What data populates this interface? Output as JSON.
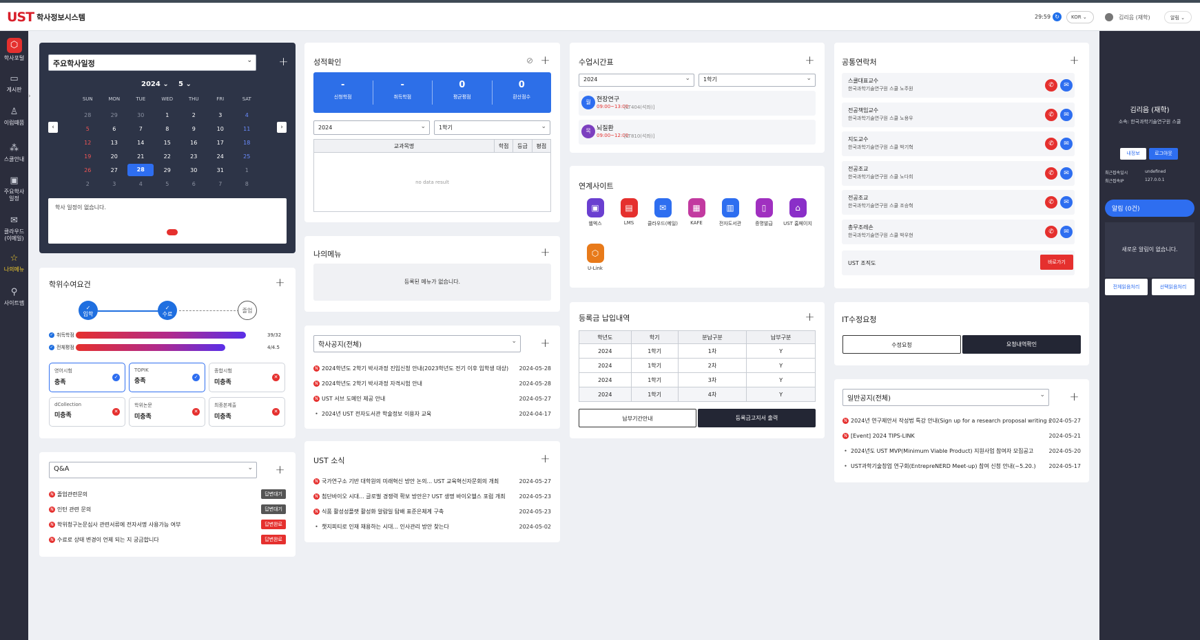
{
  "header": {
    "logo": "UST",
    "app_title": "학사정보시스템",
    "timer": "29:59",
    "lang": "KOR",
    "user_name": "김리음 (재학)",
    "alarm_label": "알림"
  },
  "sidebar": {
    "items": [
      {
        "label": "학사포털",
        "icon": "portal-icon"
      },
      {
        "label": "게시판",
        "icon": "board-icon"
      },
      {
        "label": "이럼때쯤",
        "icon": "person-icon"
      },
      {
        "label": "스쿨안내",
        "icon": "school-icon"
      },
      {
        "label": "주요학사일정",
        "icon": "schedule-icon"
      },
      {
        "label": "클라우드(이메일)",
        "icon": "mail-icon"
      },
      {
        "label": "나의메뉴",
        "icon": "star-icon"
      },
      {
        "label": "사이트맵",
        "icon": "sitemap-icon"
      }
    ]
  },
  "calendar": {
    "select": "주요학사일정",
    "year": "2024",
    "month": "5",
    "dow": [
      "SUN",
      "MON",
      "TUE",
      "WED",
      "THU",
      "FRI",
      "SAT"
    ],
    "weeks": [
      [
        "28",
        "29",
        "30",
        "1",
        "2",
        "3",
        "4"
      ],
      [
        "5",
        "6",
        "7",
        "8",
        "9",
        "10",
        "11"
      ],
      [
        "12",
        "13",
        "14",
        "15",
        "16",
        "17",
        "18"
      ],
      [
        "19",
        "20",
        "21",
        "22",
        "23",
        "24",
        "25"
      ],
      [
        "26",
        "27",
        "28",
        "29",
        "30",
        "31",
        "1"
      ],
      [
        "2",
        "3",
        "4",
        "5",
        "6",
        "7",
        "8"
      ]
    ],
    "empty_text": "학사 일정이 없습니다."
  },
  "degree": {
    "title": "학위수여요건",
    "steps": [
      "입학",
      "수료",
      "졸업"
    ],
    "bars": [
      {
        "label": "취득학점",
        "value": "39/32",
        "fill": 1.0
      },
      {
        "label": "전체평점",
        "value": "4/4.5",
        "fill": 0.88
      }
    ],
    "reqs": [
      {
        "title": "영어시험",
        "status": "충족",
        "ok": true
      },
      {
        "title": "TOPIK",
        "status": "충족",
        "ok": true
      },
      {
        "title": "종합시험",
        "status": "미충족",
        "ok": false
      },
      {
        "title": "dCollection",
        "status": "미충족",
        "ok": false
      },
      {
        "title": "학위논문",
        "status": "미충족",
        "ok": false
      },
      {
        "title": "최종본제출",
        "status": "미충족",
        "ok": false
      }
    ]
  },
  "qna": {
    "select": "Q&A",
    "items": [
      {
        "text": "졸업관련문의",
        "status": "답변대기",
        "done": false
      },
      {
        "text": "인턴 관련 문의",
        "status": "답변대기",
        "done": false
      },
      {
        "text": "학위청구논문심사 관련서류에 전자서명 사용가능 여부",
        "status": "답변완료",
        "done": true
      },
      {
        "text": "수료로 상태 변경이 언제 되는 지 궁금합니다",
        "status": "답변완료",
        "done": true
      }
    ]
  },
  "grades": {
    "title": "성적확인",
    "stats": [
      {
        "value": "-",
        "label": "신청학점"
      },
      {
        "value": "-",
        "label": "취득학점"
      },
      {
        "value": "0",
        "label": "평균평점"
      },
      {
        "value": "0",
        "label": "환산점수"
      }
    ],
    "year": "2024",
    "term": "1학기",
    "columns": [
      "교과목명",
      "학점",
      "등급",
      "평점"
    ],
    "empty": "no data result"
  },
  "mymenu": {
    "title": "나의메뉴",
    "empty": "등록된 메뉴가 없습니다."
  },
  "notice": {
    "select": "학사공지(전체)",
    "items": [
      {
        "text": "2024학년도 2학기 박사과정 진입신청 안내(2023학년도 전기 이후 입학생 대상)",
        "date": "2024-05-28",
        "new": true
      },
      {
        "text": "2024학년도 2학기 박사과정 자격시험 안내",
        "date": "2024-05-28",
        "new": true
      },
      {
        "text": "UST 서브 도메인 제공 안내",
        "date": "2024-05-27",
        "new": true
      },
      {
        "text": "2024년 UST 전자도서관 학술정보 이용자 교육",
        "date": "2024-04-17",
        "new": false
      }
    ]
  },
  "news": {
    "title": "UST 소식",
    "items": [
      {
        "text": "국가연구소 기반 대학원의 미래혁신 방안 논의... UST 교육혁신자문회의 개최",
        "date": "2024-05-27",
        "new": true
      },
      {
        "text": "첨단바이오 시대... 글로벌 경쟁력 확보 방안은? UST 생명 바이오헬스 포럼 개최",
        "date": "2024-05-23",
        "new": true
      },
      {
        "text": "식품 활성성플랫 활성화 알람일 탐배 표준은체계 구축",
        "date": "2024-05-23",
        "new": true
      },
      {
        "text": "챗지피티로 인재 채용하는 시대... 인사관리 방안 찾는다",
        "date": "2024-05-02",
        "new": false
      }
    ]
  },
  "timetable": {
    "title": "수업시간표",
    "year": "2024",
    "term": "1학기",
    "items": [
      {
        "circle": "월",
        "name": "현장연구",
        "time": "09:00~13:00",
        "room": "[LT404(석좌)]",
        "color": "#2e6ef0"
      },
      {
        "circle": "목",
        "name": "뇌질환",
        "time": "09:00~12:00",
        "room": "[LT810(석좌)]",
        "color": "#7c3fbf"
      }
    ]
  },
  "links": {
    "title": "연계사이트",
    "items": [
      {
        "label": "웹엑스",
        "color": "#6a3fd0",
        "icon": "webex-icon"
      },
      {
        "label": "LMS",
        "color": "#e5302e",
        "icon": "lms-icon"
      },
      {
        "label": "클라우드(메일)",
        "color": "#2e6ef0",
        "icon": "cloud-mail-icon"
      },
      {
        "label": "KAFE",
        "color": "#c23aa0",
        "icon": "kafe-icon"
      },
      {
        "label": "전자도서관",
        "color": "#2e6ef0",
        "icon": "library-icon"
      },
      {
        "label": "증명발급",
        "color": "#a030c0",
        "icon": "certificate-icon"
      },
      {
        "label": "UST 홈페이지",
        "color": "#8a2fc8",
        "icon": "home-icon"
      },
      {
        "label": "U-Link",
        "color": "#e87a1a",
        "icon": "ulink-icon"
      }
    ]
  },
  "tuition": {
    "title": "등록금 납입내역",
    "columns": [
      "학년도",
      "학기",
      "분납구분",
      "납부구분"
    ],
    "rows": [
      [
        "2024",
        "1학기",
        "1차",
        "Y"
      ],
      [
        "2024",
        "1학기",
        "2차",
        "Y"
      ],
      [
        "2024",
        "1학기",
        "3차",
        "Y"
      ],
      [
        "2024",
        "1학기",
        "4차",
        "Y"
      ]
    ],
    "btn_guide": "납부기간안내",
    "btn_print": "등록금고지서 출력"
  },
  "contacts": {
    "title": "공통연락처",
    "items": [
      {
        "name": "스쿨대표교수",
        "sub": "한국과학기술연구원 스쿨 노주원"
      },
      {
        "name": "전공책임교수",
        "sub": "한국과학기술연구원 스쿨 노용우"
      },
      {
        "name": "지도교수",
        "sub": "한국과학기술연구원 스쿨 박기혁"
      },
      {
        "name": "전공조교",
        "sub": "한국과학기술연구원 스쿨 노다희"
      },
      {
        "name": "전공조교",
        "sub": "한국과학기술연구원 스쿨 조승혁"
      },
      {
        "name": "총무조레손",
        "sub": "한국과학기술연구원 스쿨 박우현"
      }
    ],
    "org_label": "UST 조직도",
    "go_btn": "바로가기"
  },
  "it": {
    "title": "IT수정요청",
    "btn_request": "수정요청",
    "btn_history": "요청내역확인"
  },
  "general": {
    "select": "일반공지(전체)",
    "items": [
      {
        "text": "2024년 연구제안서 작성법 특강 안내(Sign up for a research proposal writing sess...",
        "date": "2024-05-27",
        "new": true
      },
      {
        "text": "[Event] 2024 TIPS-LINK",
        "date": "2024-05-21",
        "new": true
      },
      {
        "text": "2024년도 UST MVP(Minimum Viable Product) 지원사업 참여자 모집공고",
        "date": "2024-05-20",
        "new": false
      },
      {
        "text": "UST과학기술창업 연구회(EntrepreNERD Meet-up) 참여 신청 안내(~5.20.)",
        "date": "2024-05-17",
        "new": false
      }
    ]
  },
  "rpanel": {
    "name": "김리음 (재학)",
    "affiliation": "소속: 한국과학기술연구원 스쿨",
    "btn_info": "내정보",
    "btn_logout": "로그아웃",
    "last_login_label": "최근접속일시",
    "last_login_value": "undefined",
    "last_ip_label": "최근접속IP",
    "last_ip_value": "127.0.0.1",
    "alarm": "알림 (0건)",
    "alarm_empty": "새로운 알림이 없습니다.",
    "btn_all_read": "전체읽음처리",
    "btn_sel_read": "선택읽음처리"
  },
  "colors": {
    "accent": "#2e6ef0",
    "brand": "#e5302e",
    "dark": "#2b2d3c"
  }
}
